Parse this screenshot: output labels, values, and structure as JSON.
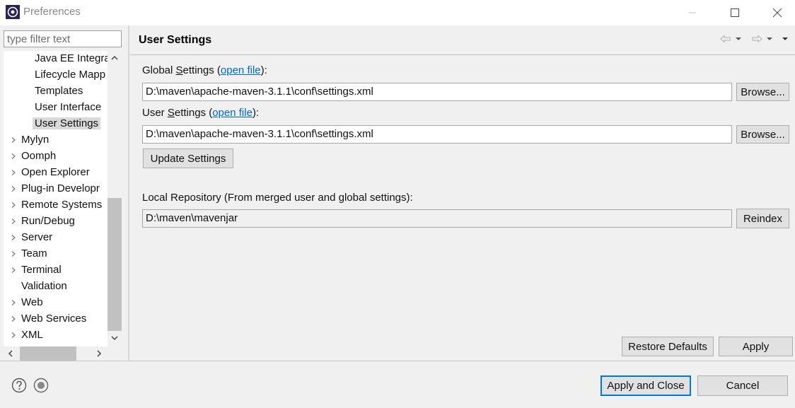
{
  "window": {
    "title": "Preferences"
  },
  "filter": {
    "placeholder": "type filter text"
  },
  "tree": {
    "items": [
      {
        "label": "Java EE Integra",
        "level": 2,
        "expandable": false
      },
      {
        "label": "Lifecycle Mapp",
        "level": 2,
        "expandable": false
      },
      {
        "label": "Templates",
        "level": 2,
        "expandable": false
      },
      {
        "label": "User Interface",
        "level": 2,
        "expandable": false
      },
      {
        "label": "User Settings",
        "level": 2,
        "expandable": false,
        "selected": true
      },
      {
        "label": "Mylyn",
        "level": 1,
        "expandable": true
      },
      {
        "label": "Oomph",
        "level": 1,
        "expandable": true
      },
      {
        "label": "Open Explorer",
        "level": 1,
        "expandable": true
      },
      {
        "label": "Plug-in Developr",
        "level": 1,
        "expandable": true
      },
      {
        "label": "Remote Systems",
        "level": 1,
        "expandable": true
      },
      {
        "label": "Run/Debug",
        "level": 1,
        "expandable": true
      },
      {
        "label": "Server",
        "level": 1,
        "expandable": true
      },
      {
        "label": "Team",
        "level": 1,
        "expandable": true
      },
      {
        "label": "Terminal",
        "level": 1,
        "expandable": true
      },
      {
        "label": "Validation",
        "level": 1,
        "expandable": false
      },
      {
        "label": "Web",
        "level": 1,
        "expandable": true
      },
      {
        "label": "Web Services",
        "level": 1,
        "expandable": true
      },
      {
        "label": "XML",
        "level": 1,
        "expandable": true
      }
    ]
  },
  "page": {
    "title": "User Settings",
    "global": {
      "label_prefix": "Global ",
      "label_mnemonic": "S",
      "label_rest": "ettings (",
      "link": "open file",
      "label_suffix": "):",
      "value": "D:\\maven\\apache-maven-3.1.1\\conf\\settings.xml",
      "browse_label": "Browse..."
    },
    "user": {
      "label_prefix": "User ",
      "label_mnemonic": "S",
      "label_rest": "ettings (",
      "link": "open file",
      "label_suffix": "):",
      "value": "D:\\maven\\apache-maven-3.1.1\\conf\\settings.xml",
      "browse_label": "Browse..."
    },
    "update_label": "Update Settings",
    "local_repo": {
      "label": "Local Repository (From merged user and global settings):",
      "value": "D:\\maven\\mavenjar",
      "reindex_label": "Reindex"
    },
    "restore_defaults_label": "Restore Defaults",
    "apply_label": "Apply"
  },
  "footer": {
    "apply_and_close_label": "Apply and Close",
    "cancel_label": "Cancel"
  },
  "icons": {
    "help": "help-icon",
    "import_export": "import-export-icon",
    "back": "back-arrow-icon",
    "forward": "forward-arrow-icon",
    "view_menu": "view-menu-icon"
  },
  "colors": {
    "link": "#0066cc",
    "default_button_border": "#0078d7",
    "selection": "#d9d9d9"
  }
}
